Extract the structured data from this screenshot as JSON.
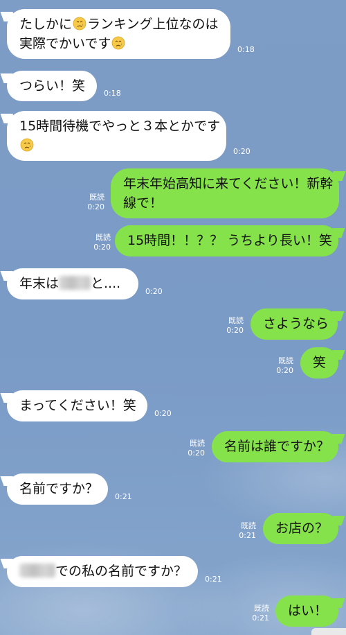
{
  "messages": [
    {
      "side": "in",
      "lines": [
        "たしかに",
        "ランキング上位なのは",
        "実際でかいです"
      ],
      "time": "0:18",
      "emoji": "crying-face-icon"
    },
    {
      "side": "in",
      "text": "つらい！笑",
      "time": "0:18"
    },
    {
      "side": "in",
      "lines": [
        "15時間待機でやっと３本とかです"
      ],
      "time": "0:20",
      "emoji": "crying-face-icon"
    },
    {
      "side": "out",
      "lines": [
        "年末年始高知に来てください！新幹",
        "線で！"
      ],
      "read": "既読",
      "time": "0:20"
    },
    {
      "side": "out",
      "text": "15時間！！？？ うちより長い！笑",
      "read": "既読",
      "time": "0:20"
    },
    {
      "side": "in",
      "text_before": "年末は",
      "text_after": "と....",
      "time": "0:20"
    },
    {
      "side": "out",
      "text": "さようなら",
      "read": "既読",
      "time": "0:20"
    },
    {
      "side": "out",
      "text": "笑",
      "read": "既読",
      "time": "0:20"
    },
    {
      "side": "in",
      "text": "まってください！笑",
      "time": "0:20"
    },
    {
      "side": "out",
      "text": "名前は誰ですか？",
      "read": "既読",
      "time": "0:20"
    },
    {
      "side": "in",
      "text": "名前ですか？",
      "time": "0:21"
    },
    {
      "side": "out",
      "text": "お店の？",
      "read": "既読",
      "time": "0:21"
    },
    {
      "side": "in",
      "text_after": "での私の名前ですか？",
      "time": "0:21"
    },
    {
      "side": "out",
      "text": "はい！",
      "read": "既読",
      "time": "0:21"
    }
  ]
}
